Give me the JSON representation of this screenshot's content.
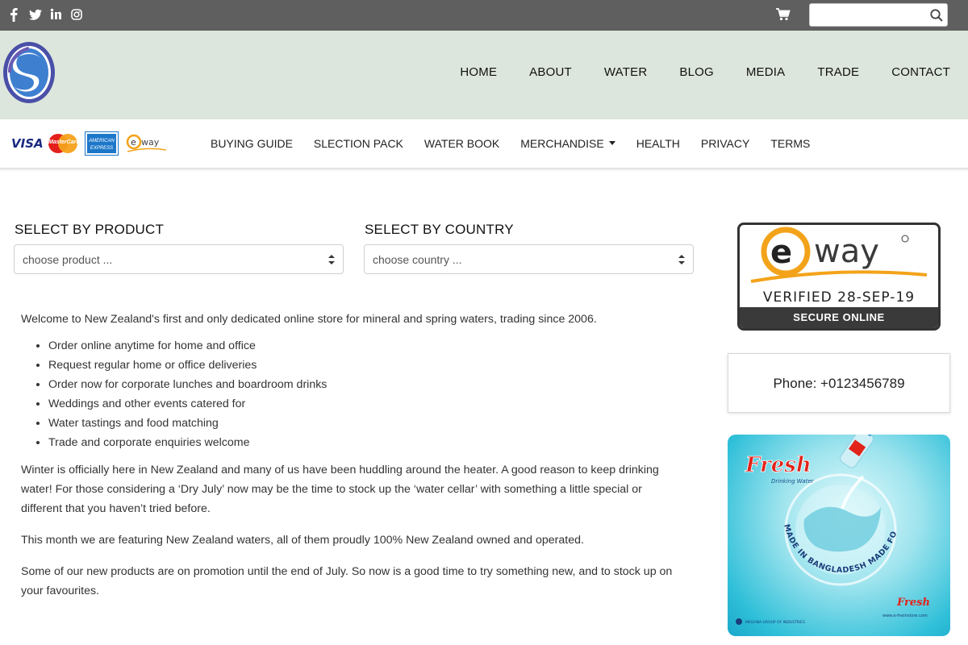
{
  "topbar": {
    "social": [
      {
        "icon": "facebook-icon",
        "glyph": "f"
      },
      {
        "icon": "twitter-icon",
        "glyph": "t"
      },
      {
        "icon": "linkedin-icon",
        "glyph": "in"
      },
      {
        "icon": "instagram-icon",
        "glyph": "◎"
      }
    ],
    "search_placeholder": "",
    "search_value": ""
  },
  "mainnav": [
    "HOME",
    "ABOUT",
    "WATER",
    "BLOG",
    "MEDIA",
    "TRADE",
    "CONTACT"
  ],
  "payment": {
    "visa": "VISA",
    "mastercard": "MasterCard",
    "amex": "AMERICAN EXPRESS",
    "eway_small": "eway"
  },
  "subnav": {
    "buying_guide": "BUYING GUIDE",
    "slection_pack": "SLECTION PACK",
    "water_book": "WATER BOOK",
    "merchandise": "MERCHANDISE",
    "health": "HEALTH",
    "privacy": "PRIVACY",
    "terms": "TERMS"
  },
  "filters": {
    "product_label": "SELECT BY PRODUCT",
    "product_value": "choose product ...",
    "country_label": "SELECT BY COUNTRY",
    "country_value": "choose country ..."
  },
  "content": {
    "intro": "Welcome to New Zealand's first and only dedicated online store for mineral and spring waters, trading since 2006.",
    "bullets": [
      "Order online anytime for home and office",
      "Request regular home or office deliveries",
      "Order now for corporate lunches and boardroom drinks",
      "Weddings and other events catered for",
      "Water tastings and food matching",
      "Trade and corporate enquiries welcome"
    ],
    "p2": "Winter is officially here in New Zealand and many of us have been huddling around the heater. A good reason to keep drinking water! For those considering a ‘Dry July’ now may be the time to stock up the ‘water cellar’ with something a little special or different that you haven’t tried before.",
    "p3": "This month we are featuring New Zealand waters, all of them proudly 100% New Zealand owned and operated.",
    "p4": "Some of our new products are on promotion until the end of July. So now is a good time to try something new, and to stock up on your favourites."
  },
  "sidebar": {
    "eway_brand": "way",
    "eway_verified": "VERIFIED 28-SEP-19",
    "eway_secure": "SECURE ONLINE",
    "phone": "Phone: +0123456789",
    "ad_brand": "Fresh",
    "ad_tagline": "Drinking Water",
    "ad_made_in": "MADE IN BANGLADESH MADE FOR THE WORLD",
    "ad_brand_small": "Fresh",
    "ad_group": "MEGHNA GROUP OF INDUSTRIES",
    "ad_url": "www.e-freshstore.com"
  },
  "colors": {
    "topbar_bg": "#5f5f5f",
    "header_bg": "#dde6dc",
    "eway_orange": "#f3a31a",
    "fresh_red": "#e2231a"
  }
}
